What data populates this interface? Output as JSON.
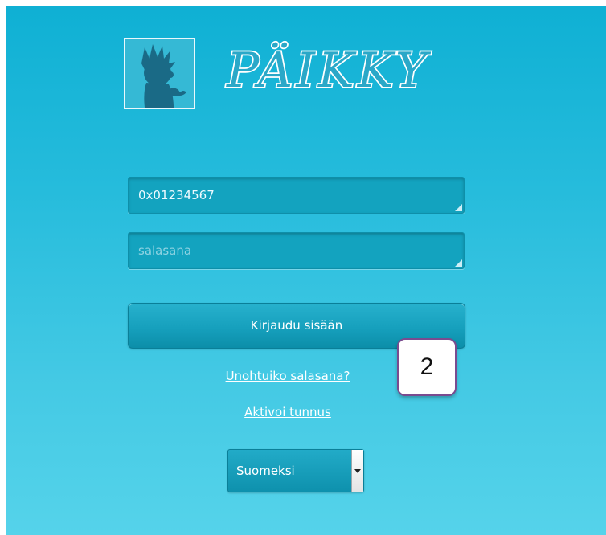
{
  "brand": {
    "name": "PÄIKKY",
    "logo_icon": "child-silhouette-icon"
  },
  "login_form": {
    "username": {
      "value": "0x01234567",
      "placeholder": ""
    },
    "password": {
      "value": "",
      "placeholder": "salasana"
    },
    "submit_label": "Kirjaudu sisään",
    "forgot_password_label": "Unohtuiko salasana?",
    "activate_account_label": "Aktivoi tunnus"
  },
  "annotation": {
    "label": "2"
  },
  "language": {
    "selected": "Suomeksi",
    "icon": "chevron-down-icon"
  },
  "colors": {
    "background_top": "#0fb0d4",
    "background_bottom": "#55d3ea",
    "field": "#13a3bf",
    "badge_border": "#7a4b8f"
  }
}
